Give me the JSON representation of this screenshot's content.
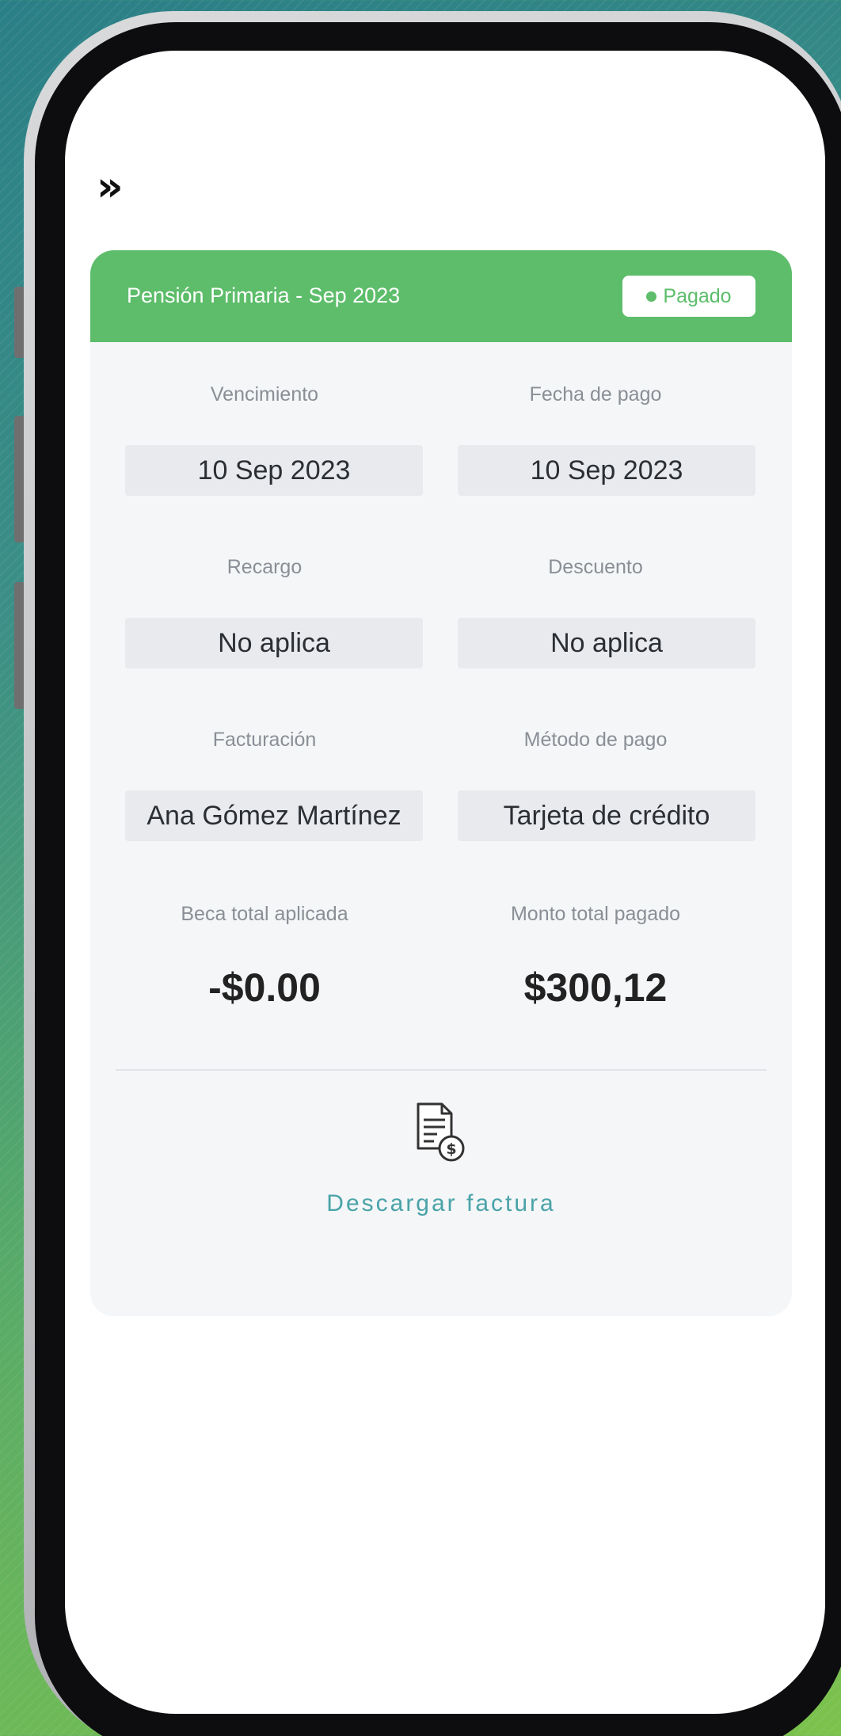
{
  "nav": {
    "collapse_icon": "double-chevron-right-icon",
    "collapse_glyph": "»"
  },
  "card": {
    "title": "Pensión Primaria - Sep 2023",
    "status": "Pagado",
    "header_color": "#5dbd6a"
  },
  "fields": {
    "vencimiento": {
      "label": "Vencimiento",
      "value": "10 Sep 2023"
    },
    "fecha_pago": {
      "label": "Fecha de pago",
      "value": "10 Sep 2023"
    },
    "recargo": {
      "label": "Recargo",
      "value": "No aplica"
    },
    "descuento": {
      "label": "Descuento",
      "value": "No aplica"
    },
    "facturacion": {
      "label": "Facturación",
      "value": "Ana Gómez Martínez"
    },
    "metodo_pago": {
      "label": "Método de pago",
      "value": "Tarjeta de crédito"
    }
  },
  "totals": {
    "beca": {
      "label": "Beca total aplicada",
      "value": "-$0.00"
    },
    "monto": {
      "label": "Monto total pagado",
      "value": "$300,12"
    }
  },
  "download": {
    "icon": "invoice-dollar-icon",
    "label": "Descargar factura",
    "link_color": "#4aa3a8"
  }
}
